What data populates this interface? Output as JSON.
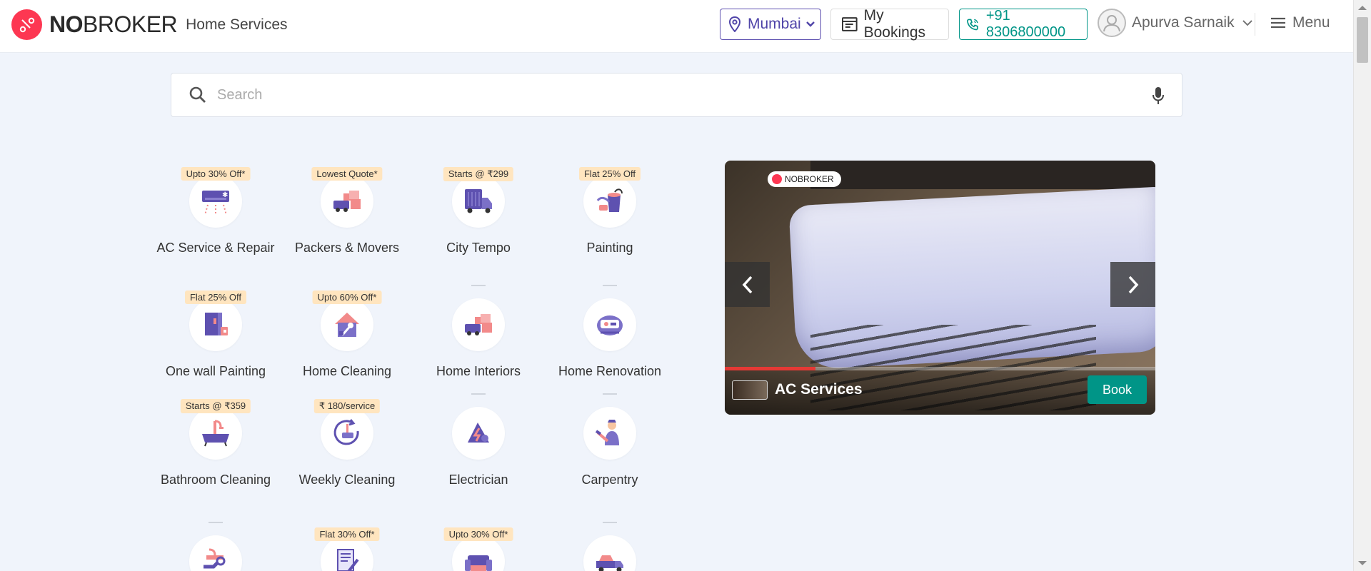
{
  "header": {
    "brand_bold": "NO",
    "brand_rest": "BROKER",
    "brand_sub": "Home Services",
    "location": "Mumbai",
    "bookings": "My Bookings",
    "phone": "+91 8306800000",
    "user": "Apurva Sarnaik",
    "menu": "Menu"
  },
  "search": {
    "placeholder": "Search"
  },
  "services": [
    {
      "label": "AC Service & Repair",
      "badge": "Upto 30% Off*",
      "icon": "ac-icon"
    },
    {
      "label": "Packers & Movers",
      "badge": "Lowest Quote*",
      "icon": "truck-boxes-icon"
    },
    {
      "label": "City Tempo",
      "badge": "Starts @ ₹299",
      "icon": "tempo-icon"
    },
    {
      "label": "Painting",
      "badge": "Flat 25% Off",
      "icon": "paint-bucket-icon"
    },
    {
      "label": "One wall Painting",
      "badge": "Flat 25% Off",
      "icon": "wall-paint-icon"
    },
    {
      "label": "Home Cleaning",
      "badge": "Upto 60% Off*",
      "icon": "home-cleaning-icon"
    },
    {
      "label": "Home Interiors",
      "badge": "",
      "icon": "interiors-icon"
    },
    {
      "label": "Home Renovation",
      "badge": "",
      "icon": "renovation-icon"
    },
    {
      "label": "Bathroom Cleaning",
      "badge": "Starts @ ₹359",
      "icon": "bathtub-icon"
    },
    {
      "label": "Weekly Cleaning",
      "badge": "₹ 180/service",
      "icon": "weekly-cleaning-icon"
    },
    {
      "label": "Electrician",
      "badge": "",
      "icon": "electrician-icon"
    },
    {
      "label": "Carpentry",
      "badge": "",
      "icon": "carpentry-icon"
    },
    {
      "label": "",
      "badge": "",
      "icon": "plumbing-icon"
    },
    {
      "label": "",
      "badge": "Flat 30% Off*",
      "icon": "document-icon"
    },
    {
      "label": "",
      "badge": "Upto 30% Off*",
      "icon": "sofa-icon"
    },
    {
      "label": "",
      "badge": "",
      "icon": "car-transport-icon"
    }
  ],
  "video": {
    "title": "AC Services",
    "book": "Book",
    "brand_label": "NOBROKER",
    "progress": 0.21
  },
  "colors": {
    "brand": "#fd3752",
    "accent": "#5e51b0",
    "teal": "#009587",
    "badge": "#ffe5bf",
    "background": "#f0f4fb"
  }
}
